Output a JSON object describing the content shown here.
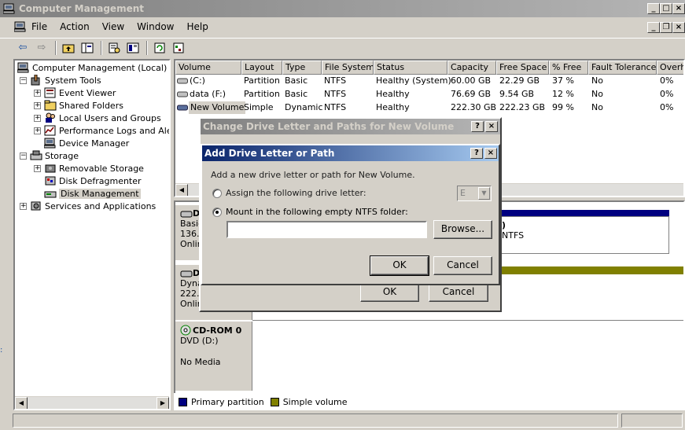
{
  "window": {
    "title": "Computer Management",
    "colors": {
      "titlebar_inactive": "#808080",
      "dialog_active": "#0a246a",
      "primary_partition": "#000080",
      "simple_volume": "#808000"
    }
  },
  "menu": {
    "items": [
      "File",
      "Action",
      "View",
      "Window",
      "Help"
    ]
  },
  "tree": {
    "root": "Computer Management (Local)",
    "system_tools": "System Tools",
    "event_viewer": "Event Viewer",
    "shared_folders": "Shared Folders",
    "local_users": "Local Users and Groups",
    "perf_logs": "Performance Logs and Alerts",
    "device_manager": "Device Manager",
    "storage": "Storage",
    "removable_storage": "Removable Storage",
    "disk_defrag": "Disk Defragmenter",
    "disk_management": "Disk Management",
    "services_apps": "Services and Applications"
  },
  "volume_list": {
    "columns": [
      "Volume",
      "Layout",
      "Type",
      "File System",
      "Status",
      "Capacity",
      "Free Space",
      "% Free",
      "Fault Tolerance",
      "Overhe"
    ],
    "rows": [
      {
        "volume": "(C:)",
        "layout": "Partition",
        "type": "Basic",
        "fs": "NTFS",
        "status": "Healthy (System)",
        "capacity": "60.00 GB",
        "free": "22.29 GB",
        "pct": "37 %",
        "fault": "No",
        "overhead": "0%"
      },
      {
        "volume": "data (F:)",
        "layout": "Partition",
        "type": "Basic",
        "fs": "NTFS",
        "status": "Healthy",
        "capacity": "76.69 GB",
        "free": "9.54 GB",
        "pct": "12 %",
        "fault": "No",
        "overhead": "0%"
      },
      {
        "volume": "New Volume",
        "layout": "Simple",
        "type": "Dynamic",
        "fs": "NTFS",
        "status": "Healthy",
        "capacity": "222.30 GB",
        "free": "222.23 GB",
        "pct": "99 %",
        "fault": "No",
        "overhead": "0%"
      }
    ]
  },
  "disks": {
    "disk0": {
      "name": "D",
      "type": "Basic",
      "size": "136.",
      "status": "Onlin"
    },
    "disk0_partial": {
      "letter": ")",
      "fs": "NTFS"
    },
    "disk1": {
      "name": "D",
      "type": "Dyna",
      "size": "222.",
      "status": "Onlin"
    },
    "cdrom": {
      "name": "CD-ROM 0",
      "type": "DVD (D:)",
      "status": "No Media"
    }
  },
  "legend": {
    "primary": "Primary partition",
    "simple": "Simple volume"
  },
  "dialog_change": {
    "title": "Change Drive Letter and Paths for New Volume",
    "ok": "OK",
    "cancel": "Cancel",
    "help": "?",
    "close": "×"
  },
  "dialog_add": {
    "title": "Add Drive Letter or Path",
    "prompt": "Add a new drive letter or path for New Volume.",
    "assign_label": "Assign the following drive letter:",
    "drive_letter": "E",
    "mount_label": "Mount in the following empty NTFS folder:",
    "folder_value": "",
    "browse": "Browse...",
    "ok": "OK",
    "cancel": "Cancel",
    "help": "?",
    "close": "×"
  }
}
